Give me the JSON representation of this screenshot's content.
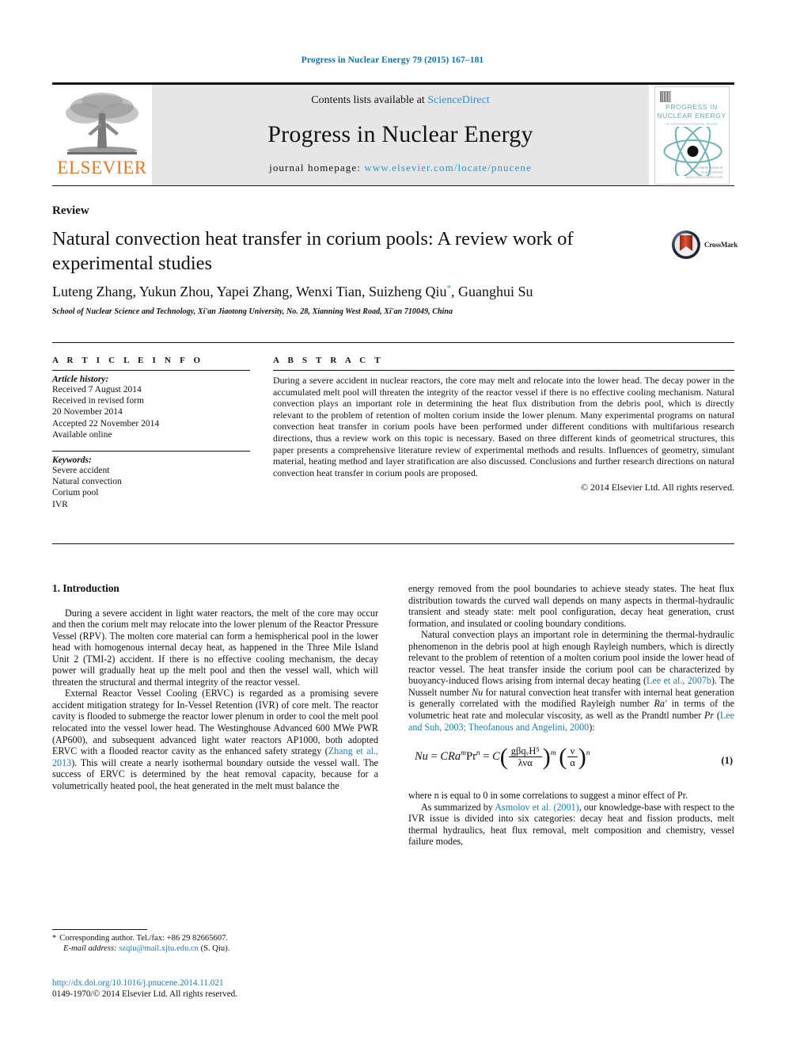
{
  "running_head": "Progress in Nuclear Energy 79 (2015) 167–181",
  "masthead": {
    "publisher": "ELSEVIER",
    "contents_prefix": "Contents lists available at ",
    "contents_link": "ScienceDirect",
    "journal_title": "Progress in Nuclear Energy",
    "homepage_label": "journal homepage: ",
    "homepage_url": "www.elsevier.com/locate/pnucene",
    "cover": {
      "title_line1": "PROGRESS IN",
      "title_line2": "NUCLEAR ENERGY",
      "subtitle": "An International Review Journal",
      "foot_line1": "Available online at",
      "foot_line2": "ScienceDirect",
      "foot_line3": "www.sciencedirect.com"
    },
    "accent_link_color": "#2a94d6",
    "elsevier_orange": "#e87722"
  },
  "article": {
    "doctype": "Review",
    "title": "Natural convection heat transfer in corium pools: A review work of experimental studies",
    "authors_pre": "Luteng Zhang, Yukun Zhou, Yapei Zhang, Wenxi Tian, Suizheng Qiu",
    "authors_marker": "*",
    "authors_post": ", Guanghui Su",
    "affiliation": "School of Nuclear Science and Technology, Xi'an Jiaotong University, No. 28, Xianning West Road, Xi'an 710049, China",
    "crossmark_label": "CrossMark"
  },
  "article_info": {
    "heading": "A R T I C L E  I N F O",
    "history_label": "Article history:",
    "history": [
      "Received 7 August 2014",
      "Received in revised form",
      "20 November 2014",
      "Accepted 22 November 2014",
      "Available online"
    ],
    "keywords_label": "Keywords:",
    "keywords": [
      "Severe accident",
      "Natural convection",
      "Corium pool",
      "IVR"
    ]
  },
  "abstract": {
    "heading": "A B S T R A C T",
    "text": "During a severe accident in nuclear reactors, the core may melt and relocate into the lower head. The decay power in the accumulated melt pool will threaten the integrity of the reactor vessel if there is no effective cooling mechanism. Natural convection plays an important role in determining the heat flux distribution from the debris pool, which is directly relevant to the problem of retention of molten corium inside the lower plenum. Many experimental programs on natural convection heat transfer in corium pools have been performed under different conditions with multifarious research directions, thus a review work on this topic is necessary. Based on three different kinds of geometrical structures, this paper presents a comprehensive literature review of experimental methods and results. Influences of geometry, simulant material, heating method and layer stratification are also discussed. Conclusions and further research directions on natural convection heat transfer in corium pools are proposed.",
    "copyright": "© 2014 Elsevier Ltd. All rights reserved."
  },
  "body": {
    "section_heading": "1. Introduction",
    "left_p1": "During a severe accident in light water reactors, the melt of the core may occur and then the corium melt may relocate into the lower plenum of the Reactor Pressure Vessel (RPV). The molten core material can form a hemispherical pool in the lower head with homogenous internal decay heat, as happened in the Three Mile Island Unit 2 (TMI-2) accident. If there is no effective cooling mechanism, the decay power will gradually heat up the melt pool and then the vessel wall, which will threaten the structural and thermal integrity of the reactor vessel.",
    "left_p2_a": "External Reactor Vessel Cooling (ERVC) is regarded as a promising severe accident mitigation strategy for In-Vessel Retention (IVR) of core melt. The reactor cavity is flooded to submerge the reactor lower plenum in order to cool the melt pool relocated into the vessel lower head. The Westinghouse Advanced 600 MWe PWR (AP600), and subsequent advanced light water reactors AP1000, both adopted ERVC with a flooded reactor cavity as the enhanced safety strategy (",
    "left_p2_ref": "Zhang et al., 2013",
    "left_p2_b": "). This will create a nearly isothermal boundary outside the vessel wall. The success of ERVC is determined by the heat removal capacity, because for a volumetrically heated pool, the heat generated in the melt must balance the",
    "right_p1": "energy removed from the pool boundaries to achieve steady states. The heat flux distribution towards the curved wall depends on many aspects in thermal-hydraulic transient and steady state: melt pool configuration, decay heat generation, crust formation, and insulated or cooling boundary conditions.",
    "right_p2_a": "Natural convection plays an important role in determining the thermal-hydraulic phenomenon in the debris pool at high enough Rayleigh numbers, which is directly relevant to the problem of retention of a molten corium pool inside the lower head of reactor vessel. The heat transfer inside the corium pool can be characterized by buoyancy-induced flows arising from internal decay heating (",
    "right_p2_ref1": "Lee et al., 2007b",
    "right_p2_b": "). The Nusselt number ",
    "right_p2_nu": "Nu",
    "right_p2_c": " for natural convection heat transfer with internal heat generation is generally correlated with the modified Rayleigh number ",
    "right_p2_ra": "Ra'",
    "right_p2_d": " in terms of the volumetric heat rate and molecular viscosity, as well as the Prandtl number ",
    "right_p2_pr": "Pr",
    "right_p2_e": " (",
    "right_p2_ref2": "Lee and Suh, 2003; Theofanous and Angelini, 2000",
    "right_p2_f": "):",
    "equation_number": "(1)",
    "equation_plain": "Nu = CRa^m Pr^n = C ( gβq_v H^5 / λνα )^m ( ν/α )^n",
    "right_p3": "where n is equal to 0 in some correlations to suggest a minor effect of Pr.",
    "right_p4_a": "As summarized by ",
    "right_p4_ref": "Asmolov et al. (2001)",
    "right_p4_b": ", our knowledge-base with respect to the IVR issue is divided into six categories: decay heat and fission products, melt thermal hydraulics, heat flux removal, melt composition and chemistry, vessel failure modes,"
  },
  "footer": {
    "corresponding_star": "*",
    "corresponding_text": "Corresponding author. Tel./fax: +86 29 82665607.",
    "email_label": "E-mail address:",
    "email": "szqiu@mail.xjtu.edu.cn",
    "email_owner": "(S. Qiu).",
    "doi": "http://dx.doi.org/10.1016/j.pnucene.2014.11.021",
    "issn_line": "0149-1970/© 2014 Elsevier Ltd. All rights reserved."
  },
  "equation_symbols": {
    "lhs": "Nu",
    "eq1": "=",
    "c1": "C",
    "ra": "Ra",
    "m": "m",
    "pr": "Pr",
    "n": "n",
    "eq2": "=",
    "c2": "C",
    "num": "gβqᵥH⁵",
    "den": "λνα",
    "exp_m": "m",
    "num2": "ν",
    "den2": "α",
    "exp_n": "n"
  }
}
